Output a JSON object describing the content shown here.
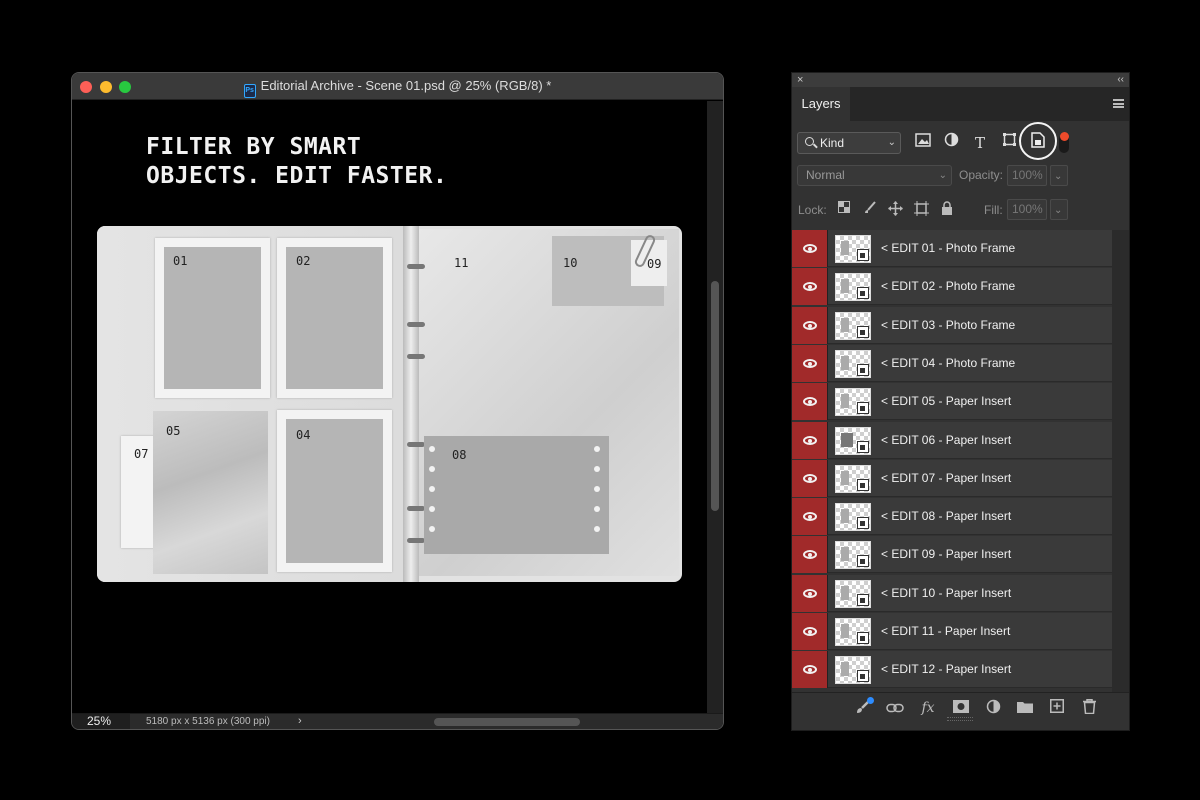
{
  "document": {
    "title": "Editorial Archive - Scene 01.psd @ 25% (RGB/8) *",
    "ps_badge": "Ps",
    "zoom": "25%",
    "doc_size": "5180 px x 5136 px (300 ppi)",
    "arrow": "›",
    "headline_line1": "FILTER BY SMART",
    "headline_line2": "OBJECTS. EDIT FASTER.",
    "slots": [
      "01",
      "02",
      "11",
      "10",
      "09",
      "05",
      "04",
      "07",
      "08"
    ]
  },
  "panel": {
    "close": "×",
    "collapse": "‹‹",
    "tab_label": "Layers",
    "filter_kind": "Kind",
    "filter_icons": [
      "image-filter-icon",
      "adjustment-filter-icon",
      "type-filter-icon",
      "shape-filter-icon",
      "smart-object-filter-icon"
    ],
    "blend_mode": "Normal",
    "opacity_label": "Opacity:",
    "opacity_value": "100%",
    "lock_label": "Lock:",
    "fill_label": "Fill:",
    "fill_value": "100%",
    "accent_color": "#ee4b2b",
    "eye_column_color": "#a12a2a",
    "layers": [
      {
        "name": "< EDIT 01 - Photo Frame"
      },
      {
        "name": "< EDIT 02 - Photo Frame"
      },
      {
        "name": "< EDIT 03 - Photo Frame"
      },
      {
        "name": "< EDIT 04 - Photo Frame"
      },
      {
        "name": "< EDIT 05 - Paper Insert"
      },
      {
        "name": "< EDIT 06 - Paper Insert"
      },
      {
        "name": "< EDIT 07 - Paper Insert"
      },
      {
        "name": "< EDIT 08 - Paper Insert"
      },
      {
        "name": "< EDIT 09 - Paper Insert"
      },
      {
        "name": "< EDIT 10 - Paper Insert"
      },
      {
        "name": "< EDIT 11 - Paper Insert"
      },
      {
        "name": "< EDIT 12 - Paper Insert"
      }
    ],
    "bottom_icons": [
      "brush-icon",
      "link-icon",
      "fx-icon",
      "mask-icon",
      "adjustment-icon",
      "folder-icon",
      "new-layer-icon",
      "trash-icon"
    ]
  }
}
